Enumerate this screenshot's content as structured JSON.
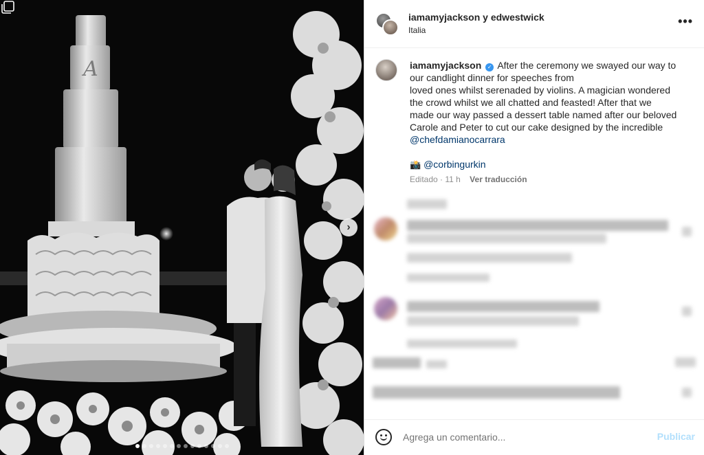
{
  "post": {
    "owners": "iamamyjackson y edwestwick",
    "location": "Italia",
    "more_icon": "more-horizontal-icon"
  },
  "caption": {
    "username": "iamamyjackson",
    "verified_icon": "verified-badge-icon",
    "lines": [
      "After the ceremony we swayed our way to",
      "our candlight dinner for speeches from",
      "loved ones whilst serenaded by violins. A magician wondered",
      "the crowd whilst we all chatted and feasted! After that we",
      "made our way passed a dessert table named after our beloved",
      "Carole and Peter to cut our cake designed by the incredible"
    ],
    "mention": "@chefdamianocarrara",
    "photo_credit_emoji": "📸",
    "photo_credit": "@corbingurkin",
    "edited": "Editado · 11 h",
    "translate": "Ver traducción"
  },
  "footer": {
    "emoji_icon": "emoji-smile-icon",
    "comment_placeholder": "Agrega un comentario...",
    "publish_label": "Publicar"
  },
  "carousel": {
    "total_slides": 14,
    "active_index": 0
  },
  "colors": {
    "accent_link": "#00376b",
    "verified": "#3897f0",
    "publish_disabled": "#b2dffc",
    "meta_gray": "#8e8e8e"
  }
}
